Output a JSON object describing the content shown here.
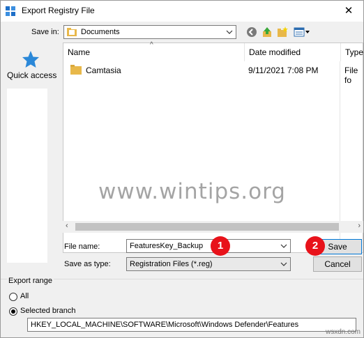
{
  "window": {
    "title": "Export Registry File",
    "close_glyph": "✕"
  },
  "save_in": {
    "label": "Save in:",
    "value": "Documents"
  },
  "places": {
    "quick_access": "Quick access"
  },
  "columns": {
    "name": "Name",
    "date_modified": "Date modified",
    "type": "Type"
  },
  "files": [
    {
      "name": "Camtasia",
      "date_modified": "9/11/2021 7:08 PM",
      "type": "File fo"
    }
  ],
  "file_name": {
    "label": "File name:",
    "value": "FeaturesKey_Backup"
  },
  "save_as_type": {
    "label": "Save as type:",
    "value": "Registration Files (*.reg)"
  },
  "buttons": {
    "save": "Save",
    "cancel": "Cancel"
  },
  "badges": {
    "first": "1",
    "second": "2"
  },
  "export_range": {
    "legend": "Export range",
    "all": "All",
    "selected_branch": "Selected branch",
    "path": "HKEY_LOCAL_MACHINE\\SOFTWARE\\Microsoft\\Windows Defender\\Features"
  },
  "watermark": "www.wintips.org",
  "footer_mark": "wsxdn.com",
  "scroll": {
    "left_arrow": "‹",
    "right_arrow": "›"
  },
  "icons": {
    "app": "registry-icon",
    "back": "back-arrow-icon",
    "up": "up-folder-icon",
    "new_folder": "new-folder-icon",
    "view": "view-menu-icon",
    "quick_access": "star-icon",
    "folder": "folder-icon",
    "dropdown": "chevron-down-icon"
  },
  "colors": {
    "badge": "#e8121a",
    "accent": "#0078d7",
    "quick_access_star": "#2b88d8",
    "folder": "#e8b84a"
  }
}
